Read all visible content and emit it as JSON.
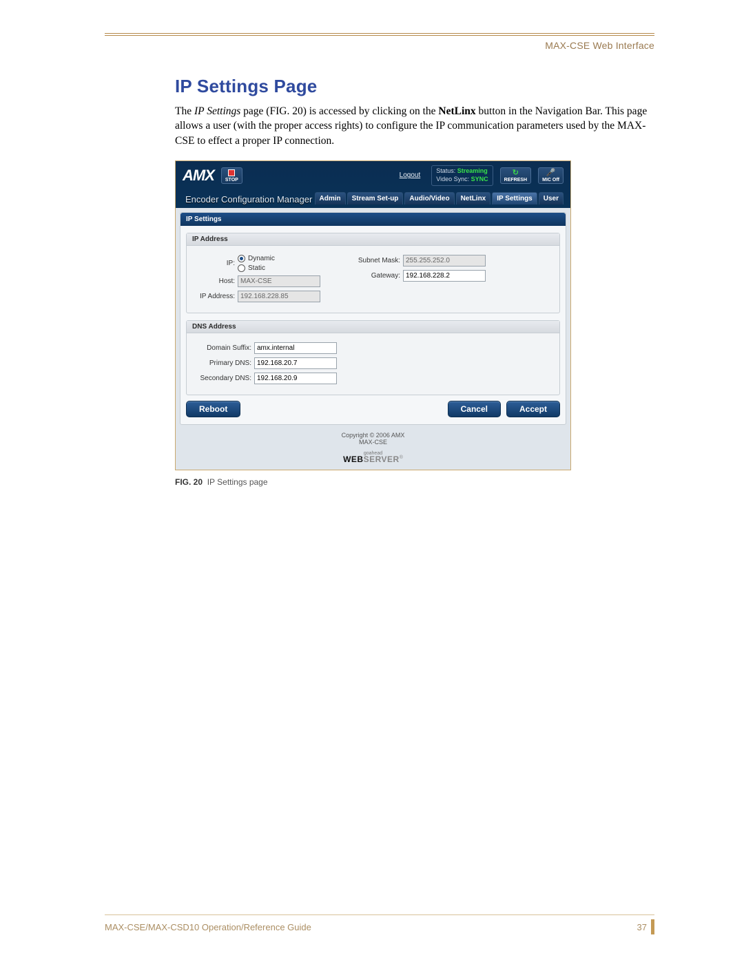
{
  "header": {
    "doc_section": "MAX-CSE Web Interface"
  },
  "section": {
    "title": "IP Settings Page",
    "p1a": "The ",
    "p1_em": "IP Settings",
    "p1b": " page (FIG. 20) is accessed by clicking on the ",
    "p1_bold": "NetLinx",
    "p1c": " button in the Navigation Bar. This page allows a user (with the proper access rights) to configure the IP communication parameters used by the MAX-CSE to effect a proper IP connection."
  },
  "screenshot": {
    "logo_text": "AMX",
    "stop_label": "STOP",
    "logout": "Logout",
    "status": {
      "status_label": "Status:",
      "status_value": "Streaming",
      "vsync_label": "Video Sync:",
      "vsync_value": "SYNC"
    },
    "refresh_label": "REFRESH",
    "mic_label": "MIC Off",
    "app_title": "Encoder Configuration Manager",
    "tabs": [
      "Admin",
      "Stream Set-up",
      "Audio/Video",
      "NetLinx",
      "IP Settings",
      "User"
    ],
    "active_tab_index": 4,
    "panel_title": "IP Settings",
    "ip_section": {
      "header": "IP Address",
      "ip_label": "IP:",
      "dynamic": "Dynamic",
      "static": "Static",
      "host_label": "Host:",
      "host_value": "MAX-CSE",
      "ipaddr_label": "IP Address:",
      "ipaddr_value": "192.168.228.85",
      "subnet_label": "Subnet Mask:",
      "subnet_value": "255.255.252.0",
      "gateway_label": "Gateway:",
      "gateway_value": "192.168.228.2"
    },
    "dns_section": {
      "header": "DNS Address",
      "suffix_label": "Domain Suffix:",
      "suffix_value": "amx.internal",
      "primary_label": "Primary DNS:",
      "primary_value": "192.168.20.7",
      "secondary_label": "Secondary DNS:",
      "secondary_value": "192.168.20.9"
    },
    "buttons": {
      "reboot": "Reboot",
      "cancel": "Cancel",
      "accept": "Accept"
    },
    "footer": {
      "copyright": "Copyright © 2006 AMX",
      "product": "MAX-CSE",
      "ws_pre": "goahead",
      "ws_a": "WEB",
      "ws_b": "SERVER"
    }
  },
  "caption": {
    "fig": "FIG. 20",
    "text": "IP Settings page"
  },
  "footer": {
    "guide": "MAX-CSE/MAX-CSD10 Operation/Reference Guide",
    "page": "37"
  }
}
